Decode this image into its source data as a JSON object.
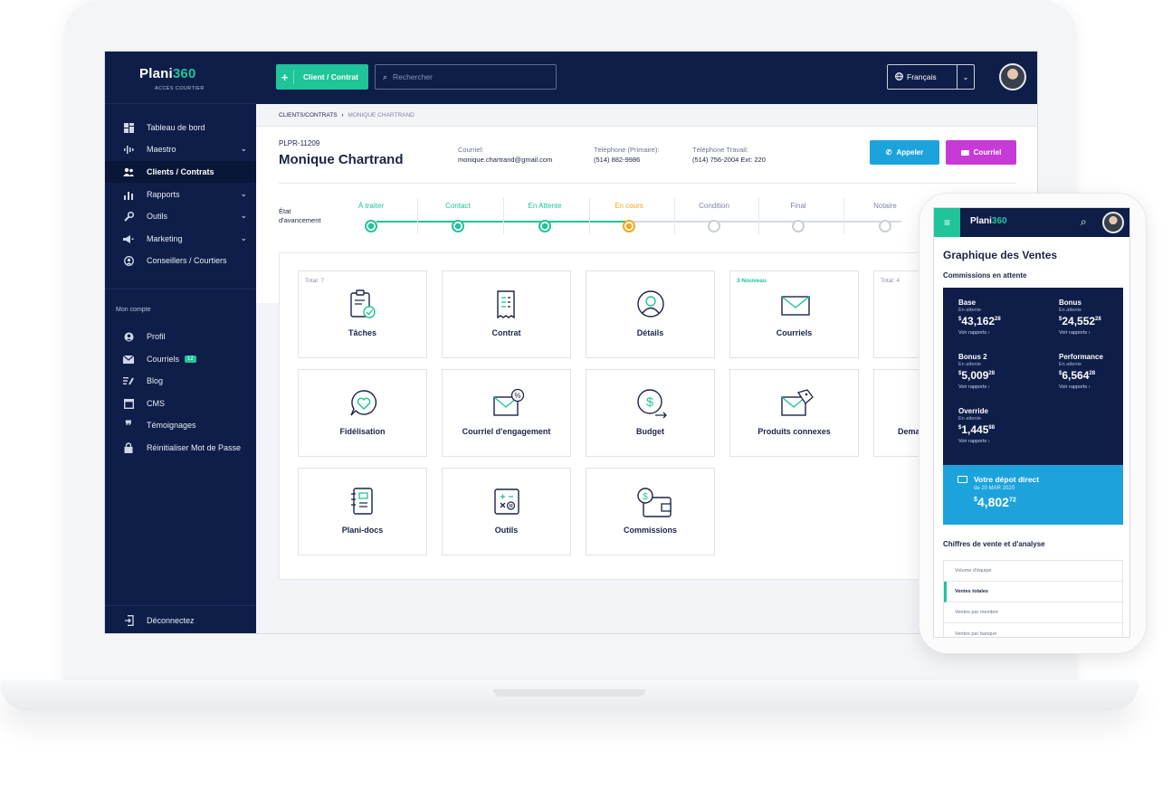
{
  "brand": {
    "name_a": "Plani",
    "name_b": "360",
    "subtitle": "ACCÈS COURTIER"
  },
  "sidebar": {
    "items": [
      {
        "label": "Tableau de bord",
        "icon": "dashboard-icon"
      },
      {
        "label": "Maestro",
        "icon": "waveform-icon",
        "expandable": true
      },
      {
        "label": "Clients / Contrats",
        "icon": "users-icon",
        "active": true
      },
      {
        "label": "Rapports",
        "icon": "bar-chart-icon",
        "expandable": true
      },
      {
        "label": "Outils",
        "icon": "wrench-icon",
        "expandable": true
      },
      {
        "label": "Marketing",
        "icon": "megaphone-icon",
        "expandable": true
      },
      {
        "label": "Conseillers / Courtiers",
        "icon": "advisor-icon"
      }
    ],
    "account_heading": "Mon compte",
    "account_items": [
      {
        "label": "Profil",
        "icon": "user-icon"
      },
      {
        "label": "Courriels",
        "icon": "envelope-icon",
        "badge": "12"
      },
      {
        "label": "Blog",
        "icon": "blog-icon"
      },
      {
        "label": "CMS",
        "icon": "window-icon"
      },
      {
        "label": "Témoignages",
        "icon": "quote-icon"
      },
      {
        "label": "Réinitialiser Mot de Passe",
        "icon": "lock-icon"
      }
    ],
    "logout": "Déconnectez"
  },
  "topbar": {
    "add_label": "Client / Contrat",
    "search_placeholder": "Rechercher",
    "language": "Français"
  },
  "breadcrumb": {
    "parent": "CLIENTS/CONTRATS",
    "separator": "›",
    "current": "MONIQUE CHARTRAND"
  },
  "client": {
    "id": "PLPR-11209",
    "name": "Monique Chartrand",
    "email_label": "Courriel:",
    "email": "monique.chartrand@gmail.com",
    "phone_primary_label": "Téléphone (Primaire):",
    "phone_primary": "(514) 882-9986",
    "phone_work_label": "Téléphone Travail:",
    "phone_work": "(514) 756-2004  Ext: 220"
  },
  "actions": {
    "call": "Appeler",
    "email": "Courriel"
  },
  "progress": {
    "label_line1": "État",
    "label_line2": "d'avancement",
    "steps": [
      {
        "label": "À traiter",
        "status": "done"
      },
      {
        "label": "Contact",
        "status": "done"
      },
      {
        "label": "En Attente",
        "status": "done"
      },
      {
        "label": "En cours",
        "status": "current"
      },
      {
        "label": "Condition",
        "status": "todo"
      },
      {
        "label": "Final",
        "status": "todo"
      },
      {
        "label": "Notaire",
        "status": "todo"
      }
    ],
    "colors": {
      "done": "#1fc498",
      "current": "#f5a623",
      "todo": "#c9ced8"
    }
  },
  "tiles": [
    {
      "label": "Tâches",
      "note": "Total: 7",
      "icon": "clipboard-check-icon"
    },
    {
      "label": "Contrat",
      "note": "",
      "icon": "receipt-icon"
    },
    {
      "label": "Détails",
      "note": "",
      "icon": "user-circle-icon"
    },
    {
      "label": "Courriels",
      "note": "3 Nouveau",
      "icon": "envelope-icon"
    },
    {
      "label": "",
      "note": "Total: 4",
      "icon": ""
    },
    {
      "label": "Fidélisation",
      "note": "",
      "icon": "heart-chat-icon"
    },
    {
      "label": "Courriel d'engagement",
      "note": "",
      "icon": "envelope-percent-icon"
    },
    {
      "label": "Budget",
      "note": "",
      "icon": "dollar-arrow-icon"
    },
    {
      "label": "Produits connexes",
      "note": "",
      "icon": "envelope-tag-icon"
    },
    {
      "label": "Dema",
      "note": "",
      "icon": ""
    },
    {
      "label": "Plani-docs",
      "note": "",
      "icon": "notebook-icon"
    },
    {
      "label": "Outils",
      "note": "",
      "icon": "calculator-icon"
    },
    {
      "label": "Commissions",
      "note": "",
      "icon": "dollar-wallet-icon"
    }
  ],
  "phone": {
    "brand_a": "Plani",
    "brand_b": "360",
    "title": "Graphique des Ventes",
    "section": "Commissions en attente",
    "commissions": [
      {
        "title": "Base",
        "status": "En attente",
        "currency": "$",
        "amount": "43,162",
        "cents": "28",
        "link": "Voir rapports"
      },
      {
        "title": "Bonus",
        "status": "En attente",
        "currency": "$",
        "amount": "24,552",
        "cents": "28",
        "link": "Voir rapports"
      },
      {
        "title": "Bonus 2",
        "status": "En attente",
        "currency": "$",
        "amount": "5,009",
        "cents": "28",
        "link": "Voir rapports"
      },
      {
        "title": "Performance",
        "status": "En attente",
        "currency": "$",
        "amount": "6,564",
        "cents": "28",
        "link": "Voir rapports"
      },
      {
        "title": "Override",
        "status": "En attente",
        "currency": "$",
        "amount": "1,445",
        "cents": "88",
        "link": "Voir rapports"
      }
    ],
    "deposit": {
      "title": "Votre dépot direct",
      "date": "de 20 MAR 2020",
      "currency": "$",
      "amount": "4,802",
      "cents": "72"
    },
    "analysis_title": "Chiffres de vente et d'analyse",
    "analysis_items": [
      "Volume d'équipe",
      "Ventes totales",
      "Ventes par membre",
      "Ventes par banque"
    ],
    "analysis_active": "Ventes totales"
  },
  "colors": {
    "navy": "#0f1e49",
    "green": "#1fc498",
    "blue": "#1da3dc",
    "magenta": "#c73ad6",
    "orange": "#f5a623"
  }
}
